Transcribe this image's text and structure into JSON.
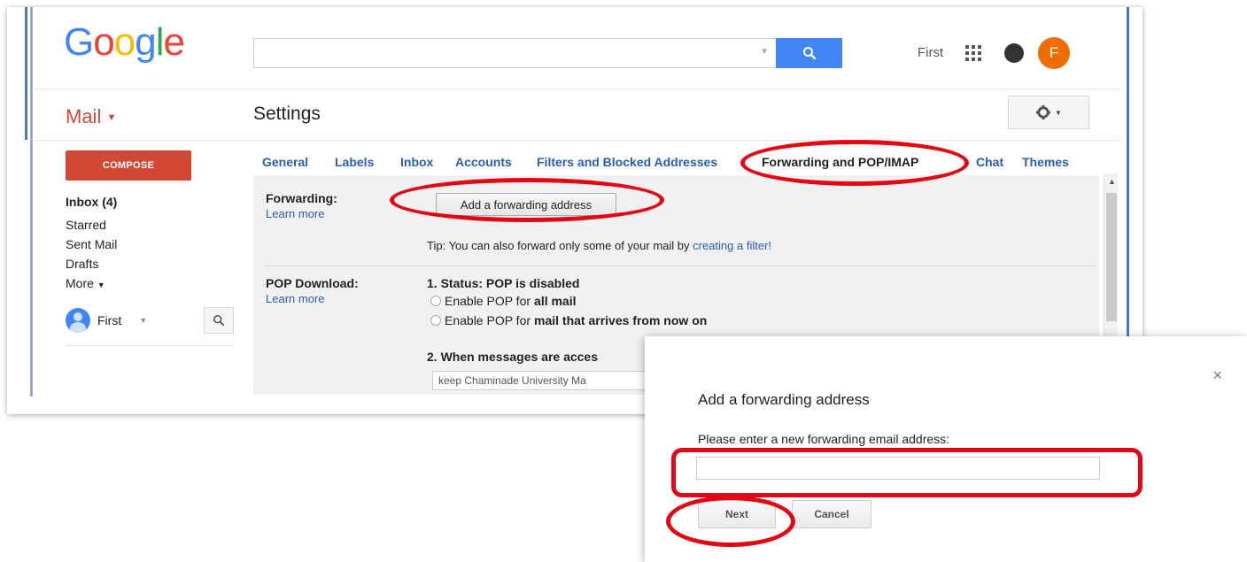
{
  "logo": {
    "text": "Google",
    "letters": [
      {
        "ch": "G",
        "color": "#4285f4"
      },
      {
        "ch": "o",
        "color": "#ea4335"
      },
      {
        "ch": "o",
        "color": "#fbbc05"
      },
      {
        "ch": "g",
        "color": "#4285f4"
      },
      {
        "ch": "l",
        "color": "#34a853"
      },
      {
        "ch": "e",
        "color": "#ea4335"
      }
    ]
  },
  "header": {
    "search_value": "",
    "account_name": "First",
    "avatar_letter": "F"
  },
  "mail_label": "Mail",
  "page_title": "Settings",
  "sidebar": {
    "compose": "COMPOSE",
    "items": [
      {
        "label": "Inbox (4)",
        "bold": true
      },
      {
        "label": "Starred"
      },
      {
        "label": "Sent Mail"
      },
      {
        "label": "Drafts"
      },
      {
        "label": "More"
      }
    ],
    "user": "First"
  },
  "tabs": [
    "General",
    "Labels",
    "Inbox",
    "Accounts",
    "Filters and Blocked Addresses",
    "Forwarding and POP/IMAP",
    "Chat",
    "Themes"
  ],
  "active_tab": "Forwarding and POP/IMAP",
  "forwarding": {
    "title": "Forwarding:",
    "learn_more": "Learn more",
    "button": "Add a forwarding address",
    "tip_prefix": "Tip: You can also forward only some of your mail by ",
    "tip_link": "creating a filter!"
  },
  "pop": {
    "title": "POP Download:",
    "learn_more": "Learn more",
    "status": "1. Status: POP is disabled",
    "option1_prefix": "Enable POP for ",
    "option1_bold": "all mail",
    "option2_prefix": "Enable POP for ",
    "option2_bold": "mail that arrives from now on",
    "when_label": "2. When messages are acces",
    "keep_value": "keep Chaminade University Ma"
  },
  "dialog": {
    "title": "Add a forwarding address",
    "prompt": "Please enter a new forwarding email address:",
    "input_value": "",
    "next": "Next",
    "cancel": "Cancel",
    "close": "×"
  },
  "colors": {
    "accent_red": "#d14836",
    "link_blue": "#2a5db0",
    "highlight_red": "#e30613",
    "search_blue": "#4285f4"
  }
}
